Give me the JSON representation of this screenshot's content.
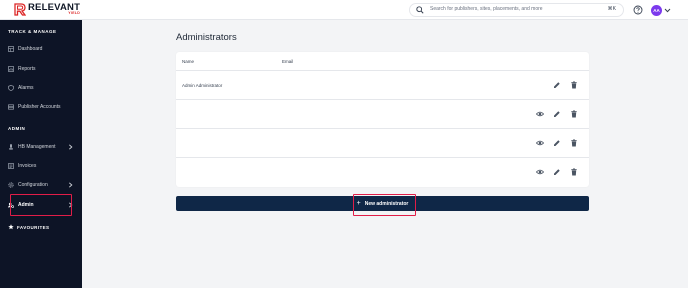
{
  "brand": {
    "name": "RELEVANT",
    "tagline": "YIELD",
    "accent": "#dc2626"
  },
  "topbar": {
    "search_placeholder": "Search for publishers, sites, placements, and more",
    "search_shortcut": "⌘K",
    "help_icon": "question-circle-icon",
    "avatar_initials": "AA",
    "avatar_color": "#7c3aed"
  },
  "sidebar": {
    "background": "#0d1426",
    "sections": [
      {
        "title": "TRACK & MANAGE",
        "items": [
          {
            "label": "Dashboard",
            "icon": "dashboard-icon"
          },
          {
            "label": "Reports",
            "icon": "reports-icon"
          },
          {
            "label": "Alarms",
            "icon": "shield-icon"
          },
          {
            "label": "Publisher Accounts",
            "icon": "table-icon"
          }
        ]
      },
      {
        "title": "ADMIN",
        "items": [
          {
            "label": "HB Management",
            "icon": "bidder-icon",
            "has_submenu": true
          },
          {
            "label": "Invoices",
            "icon": "invoice-icon"
          },
          {
            "label": "Configuration",
            "icon": "gear-icon",
            "has_submenu": true
          },
          {
            "label": "Admin",
            "icon": "admin-icon",
            "has_submenu": true,
            "active": true
          }
        ]
      }
    ],
    "favourites_label": "FAVOURITES",
    "favourites_icon": "star-icon"
  },
  "main": {
    "title": "Administrators",
    "table": {
      "columns": [
        "Name",
        "Email"
      ],
      "rows": [
        {
          "name": "Admin Administrator",
          "email": "",
          "actions": [
            "edit",
            "delete"
          ]
        },
        {
          "name": "",
          "email": "",
          "actions": [
            "view",
            "edit",
            "delete"
          ]
        },
        {
          "name": "",
          "email": "",
          "actions": [
            "view",
            "edit",
            "delete"
          ]
        },
        {
          "name": "",
          "email": "",
          "actions": [
            "view",
            "edit",
            "delete"
          ]
        }
      ]
    },
    "new_button_label": "New administrator",
    "primary_color": "#0f2747",
    "highlight_color": "#e11d48"
  }
}
